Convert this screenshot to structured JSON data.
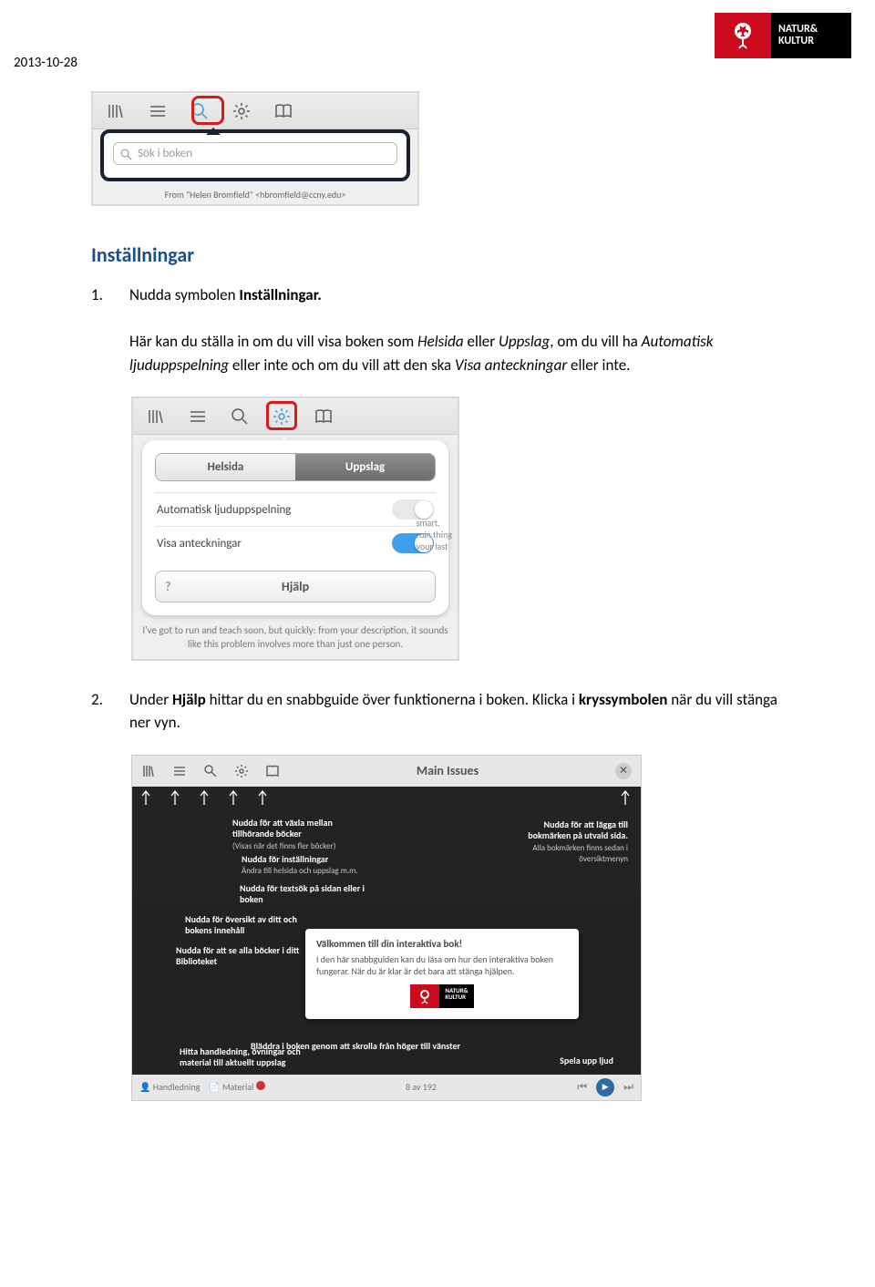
{
  "date": "2013-10-28",
  "brand": {
    "line1": "NATUR&",
    "line2": "KULTUR"
  },
  "shot1": {
    "search_placeholder": "Sök i boken",
    "from_line": "From \"Helen Bromfield\" <hbromfield@ccny.edu>"
  },
  "section_title": "Inställningar",
  "step1": {
    "num": "1.",
    "pre": "Nudda symbolen ",
    "b1": "Inställningar.",
    "p2a": "Här kan du ställa in om du vill visa boken som ",
    "i1": "Helsida",
    "p2b": " eller ",
    "i2": "Uppslag",
    "p2c": ", om du vill ha ",
    "i3": "Automatisk ljuduppspelning",
    "p2d": " eller inte och om du vill att den ska ",
    "i4": "Visa anteckningar",
    "p2e": " eller inte."
  },
  "shot2": {
    "seg_left": "Helsida",
    "seg_right": "Uppslag",
    "row1": "Automatisk ljuduppspelning",
    "row2": "Visa anteckningar",
    "help": "Hjälp",
    "side1": "smart,",
    "side2": "ruin thing",
    "side3": "your last",
    "caption": "I've got to run and teach soon, but quickly: from your description, it sounds like this problem involves more than just one person."
  },
  "step2": {
    "num": "2.",
    "a": "Under ",
    "b1": "Hjälp",
    "b": " hittar du en snabbguide över funktionerna i boken. Klicka i ",
    "b2": "kryssymbolen",
    "c": " när du vill stänga ner vyn."
  },
  "shot3": {
    "title": "Main Issues",
    "ann_books": "Nudda för att växla mellan tillhörande böcker",
    "ann_books_sub": "(Visas när det finns fler böcker)",
    "ann_settings": "Nudda för inställningar",
    "ann_settings_sub": "Ändra till helsida och uppslag m.m.",
    "ann_search": "Nudda för textsök på sidan eller i boken",
    "ann_toc": "Nudda för översikt av ditt och bokens innehåll",
    "ann_lib": "Nudda för att se alla böcker i ditt Biblioteket",
    "ann_bookmark": "Nudda för att lägga till bokmärken på utvald sida.",
    "ann_bookmark_sub": "Alla bokmärken finns sedan i översiktmenyn",
    "ann_swipe": "Bläddra i boken genom att skrolla från höger till vänster",
    "ann_material": "Hitta handledning, övningar och material till aktuellt uppslag",
    "ann_audio": "Spela upp ljud",
    "welcome_title": "Välkommen till din interaktiva bok!",
    "welcome_body": "I den här snabbguiden kan du läsa om hur den interaktiva boken fungerar. När du är klar är det bara att stänga hjälpen.",
    "bottom_left1": "Handledning",
    "bottom_left2": "Material",
    "bottom_page": "8 av 192"
  }
}
